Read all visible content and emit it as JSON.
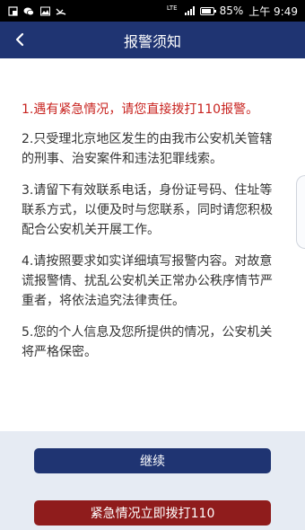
{
  "status_bar": {
    "network_label": "LTE",
    "battery": "85%",
    "time": "上午 9:49",
    "battery_level": 0.85
  },
  "nav": {
    "title": "报警须知",
    "back_icon": "chevron-left-icon"
  },
  "notices": [
    "1.遇有紧急情况，请您直接拨打110报警。",
    "2.只受理北京地区发生的由我市公安机关管辖的刑事、治安案件和违法犯罪线索。",
    "3.请留下有效联系电话，身份证号码、住址等联系方式，以便及时与您联系，同时请您积极配合公安机关开展工作。",
    "4.请按照要求如实详细填写报警内容。对故意谎报警情、扰乱公安机关正常办公秩序情节严重者，将依法追究法律责任。",
    "5.您的个人信息及您所提供的情况，公安机关将严格保密。"
  ],
  "buttons": {
    "continue_label": "继续",
    "emergency_label": "紧急情况立即拨打110"
  },
  "colors": {
    "primary": "#1f3472",
    "emergency": "#8f1c1c",
    "warning_text": "#c8231f"
  }
}
